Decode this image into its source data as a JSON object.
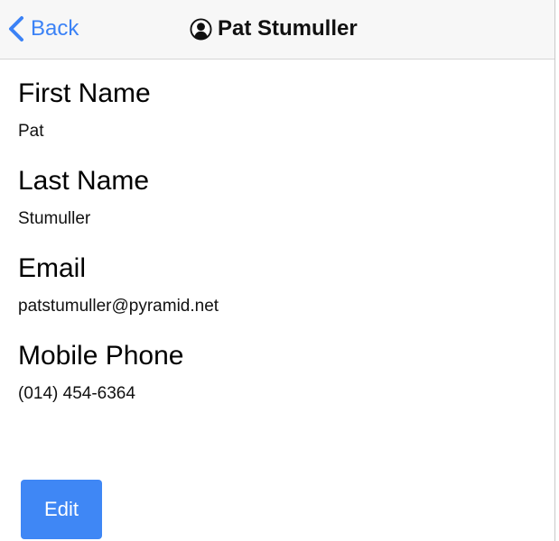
{
  "navbar": {
    "back_label": "Back",
    "title": "Pat Stumuller",
    "title_icon": "user-circle-icon",
    "accent_color": "#3b82f6"
  },
  "fields": [
    {
      "label": "First Name",
      "value": "Pat"
    },
    {
      "label": "Last Name",
      "value": "Stumuller"
    },
    {
      "label": "Email",
      "value": "patstumuller@pyramid.net"
    },
    {
      "label": "Mobile Phone",
      "value": "(014) 454-6364"
    }
  ],
  "actions": {
    "edit_label": "Edit",
    "edit_color": "#3f87f5"
  }
}
